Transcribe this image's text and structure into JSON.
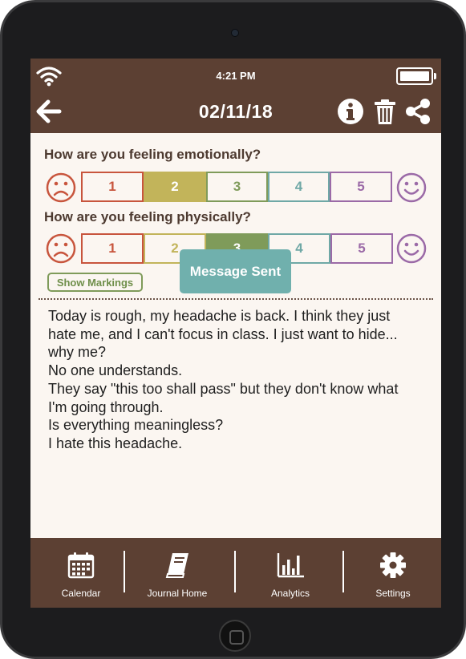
{
  "status_bar": {
    "time": "4:21 PM"
  },
  "header": {
    "date": "02/11/18"
  },
  "emotional": {
    "question": "How are you feeling emotionally?",
    "selected": "2",
    "options": [
      "1",
      "2",
      "3",
      "4",
      "5"
    ]
  },
  "physical": {
    "question": "How are you feeling physically?",
    "selected": "3",
    "options": [
      "1",
      "2",
      "3",
      "4",
      "5"
    ]
  },
  "show_markings_label": "Show Markings",
  "toast_message": "Message Sent",
  "journal": {
    "lines": [
      "Today is rough, my headache is back. I think they just",
      "hate me, and I can't focus in class. I just want to hide...",
      "why me?",
      "No one understands.",
      "They say \"this too shall pass\" but they don't know what",
      "I'm going through.",
      "Is everything meaningless?",
      "I hate this headache."
    ]
  },
  "tabs": [
    {
      "label": "Calendar",
      "icon": "calendar-icon"
    },
    {
      "label": "Journal Home",
      "icon": "book-icon"
    },
    {
      "label": "Analytics",
      "icon": "bar-chart-icon"
    },
    {
      "label": "Settings",
      "icon": "gear-icon"
    }
  ],
  "colors": {
    "brown": "#5c4033",
    "cream": "#fbf6f1",
    "scale_1": "#c8553d",
    "scale_2": "#c2b45a",
    "scale_3": "#7f9b5a",
    "scale_4": "#6fa8a6",
    "scale_5": "#9b6aa7",
    "toast": "#70b0ad"
  }
}
